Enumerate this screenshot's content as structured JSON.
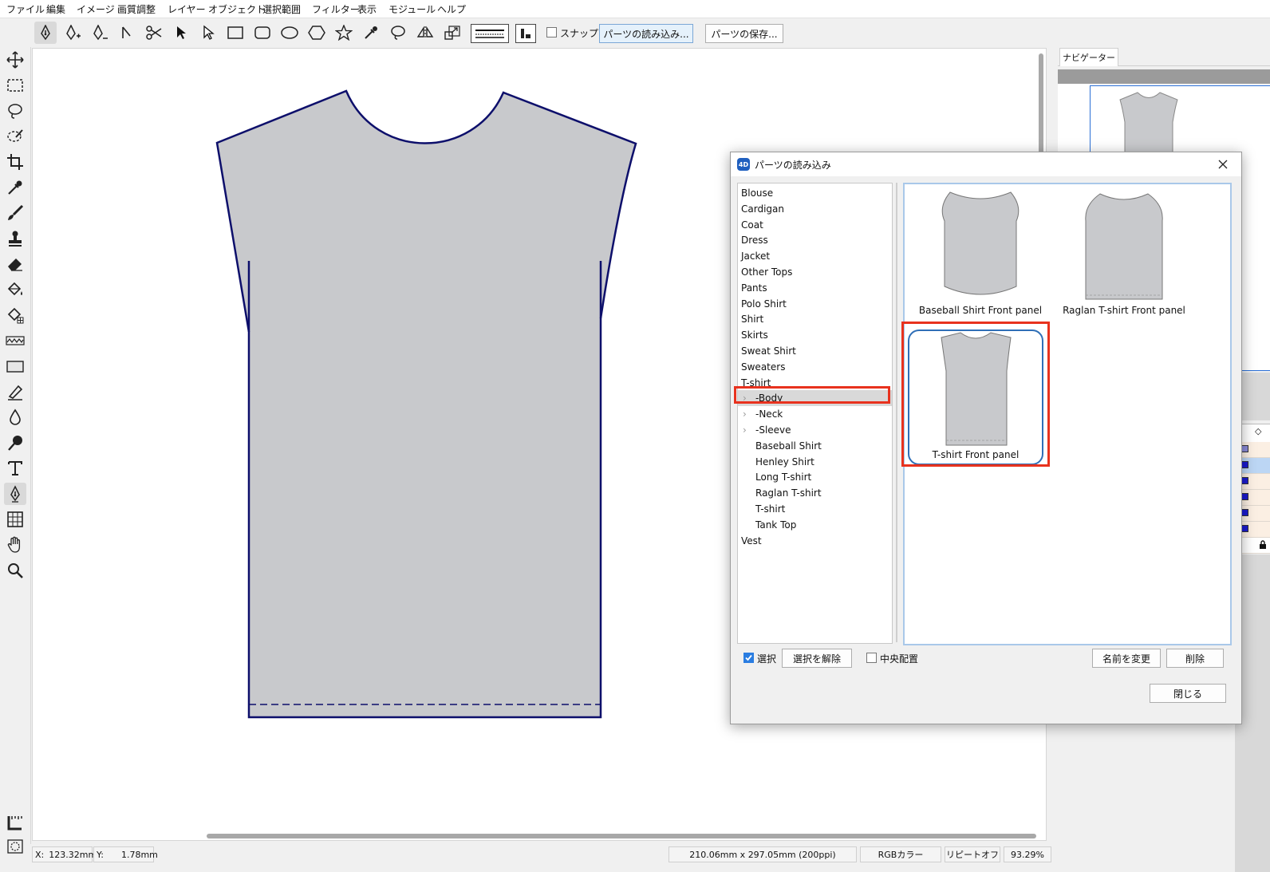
{
  "menu": [
    "ファイル",
    "編集",
    "イメージ",
    "画質調整",
    "レイヤー",
    "オブジェクト",
    "選択範囲",
    "フィルター",
    "表示",
    "モジュール",
    "ヘルプ"
  ],
  "toolbar": {
    "snap_label": "スナップ",
    "load_parts_label": "パーツの読み込み...",
    "save_parts_label": "パーツの保存..."
  },
  "navigator": {
    "tab_label": "ナビゲーター"
  },
  "status": {
    "x_label": "X:",
    "x_value": "123.32mm",
    "y_label": "Y:",
    "y_value": "1.78mm",
    "size": "210.06mm x 297.05mm (200ppi)",
    "color_mode": "RGBカラー",
    "repeat": "リピートオフ",
    "zoom": "93.29%"
  },
  "dialog": {
    "title": "パーツの読み込み",
    "app_icon_text": "4D",
    "categories": [
      {
        "label": "Blouse",
        "indent": 0
      },
      {
        "label": "Cardigan",
        "indent": 0
      },
      {
        "label": "Coat",
        "indent": 0
      },
      {
        "label": "Dress",
        "indent": 0
      },
      {
        "label": "Jacket",
        "indent": 0
      },
      {
        "label": "Other Tops",
        "indent": 0
      },
      {
        "label": "Pants",
        "indent": 0
      },
      {
        "label": "Polo Shirt",
        "indent": 0
      },
      {
        "label": "Shirt",
        "indent": 0
      },
      {
        "label": "Skirts",
        "indent": 0
      },
      {
        "label": "Sweat Shirt",
        "indent": 0
      },
      {
        "label": "Sweaters",
        "indent": 0
      },
      {
        "label": "T-shirt",
        "indent": 0
      },
      {
        "label": "-Body",
        "indent": 1,
        "expandable": true,
        "selected": true
      },
      {
        "label": "-Neck",
        "indent": 1,
        "expandable": true
      },
      {
        "label": "-Sleeve",
        "indent": 1,
        "expandable": true
      },
      {
        "label": "Baseball Shirt",
        "indent": 1
      },
      {
        "label": "Henley Shirt",
        "indent": 1
      },
      {
        "label": "Long T-shirt",
        "indent": 1
      },
      {
        "label": "Raglan T-shirt",
        "indent": 1
      },
      {
        "label": "T-shirt",
        "indent": 1
      },
      {
        "label": "Tank Top",
        "indent": 1
      },
      {
        "label": "Vest",
        "indent": 0
      }
    ],
    "thumbnails": [
      {
        "caption": "Baseball Shirt Front panel"
      },
      {
        "caption": "Raglan T-shirt Front panel"
      },
      {
        "caption": "T-shirt Front panel",
        "selected": true
      }
    ],
    "select_checkbox_label": "選択",
    "select_checked": true,
    "deselect_label": "選択を解除",
    "center_label": "中央配置",
    "center_checked": false,
    "rename_label": "名前を変更",
    "delete_label": "削除",
    "close_label": "閉じる"
  },
  "colors": {
    "pattern_fill": "#c8c9cc",
    "pattern_stroke": "#0d0f6b",
    "highlight": "#e8321e",
    "selection_border": "#2f6fb7"
  }
}
